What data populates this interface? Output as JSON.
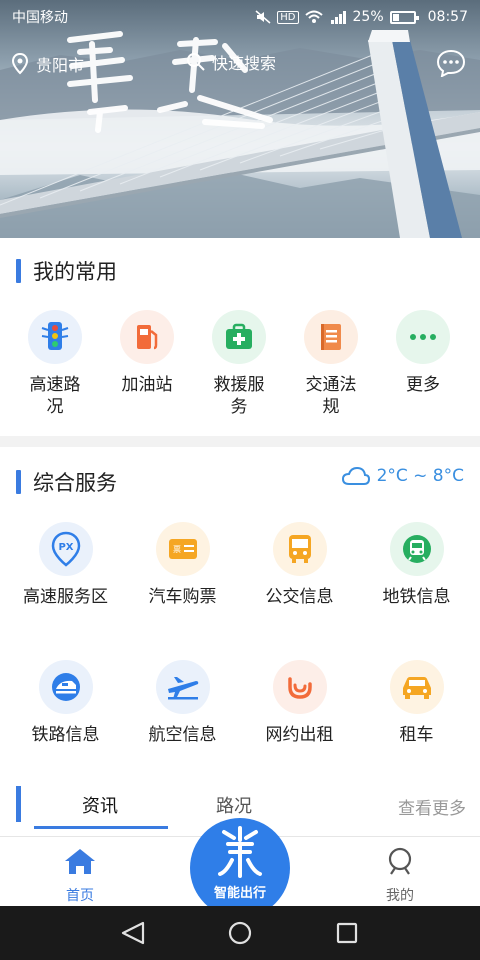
{
  "status_bar": {
    "carrier": "中国移动",
    "battery": "25%",
    "time": "08:57"
  },
  "header": {
    "location": "贵阳市",
    "search_label": "快速搜索"
  },
  "favorites": {
    "title": "我的常用",
    "items": [
      {
        "label": "高速路况",
        "icon": "traffic-light-icon",
        "color": "#2f7ee8"
      },
      {
        "label": "加油站",
        "icon": "fuel-pump-icon",
        "color": "#f26b3a"
      },
      {
        "label": "救援服务",
        "icon": "first-aid-kit-icon",
        "color": "#27ae60"
      },
      {
        "label": "交通法规",
        "icon": "rule-book-icon",
        "color": "#f08a4b"
      },
      {
        "label": "更多",
        "icon": "more-dots-icon",
        "color": "#27ae60"
      }
    ]
  },
  "services": {
    "title": "综合服务",
    "weather": "2°C ~ 8°C",
    "row1": [
      {
        "label": "高速服务区",
        "icon": "px-pin-icon",
        "color": "#2f7ee8"
      },
      {
        "label": "汽车购票",
        "icon": "ticket-icon",
        "color": "#f5a623"
      },
      {
        "label": "公交信息",
        "icon": "bus-icon",
        "color": "#f5a623"
      },
      {
        "label": "地铁信息",
        "icon": "subway-icon",
        "color": "#27ae60"
      }
    ],
    "row2": [
      {
        "label": "铁路信息",
        "icon": "train-icon",
        "color": "#2f7ee8"
      },
      {
        "label": "航空信息",
        "icon": "airplane-icon",
        "color": "#2f7ee8"
      },
      {
        "label": "网约出租",
        "icon": "rideshare-icon",
        "color": "#f26b3a"
      },
      {
        "label": "租车",
        "icon": "car-icon",
        "color": "#f5a623"
      }
    ]
  },
  "tabs": {
    "items": [
      "资讯",
      "路况"
    ],
    "active": 0,
    "more": "查看更多"
  },
  "bottom_nav": {
    "home": "首页",
    "center": "智能出行",
    "mine": "我的"
  },
  "colors": {
    "accent": "#3a7be0",
    "fab": "#2f7ee8"
  }
}
